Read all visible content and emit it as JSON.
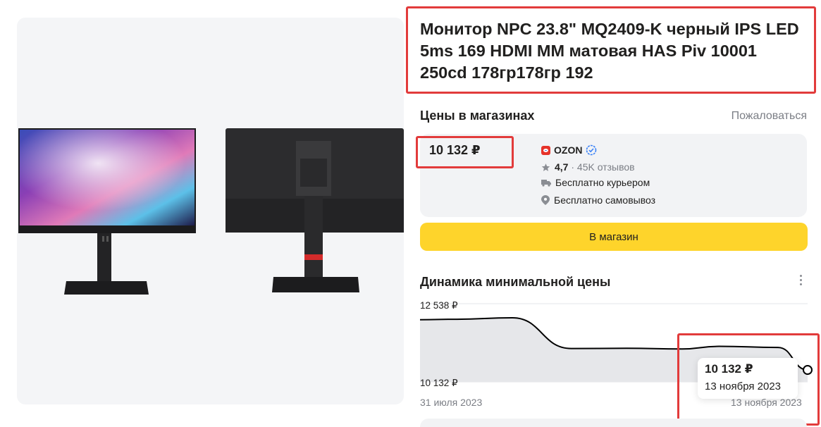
{
  "product": {
    "title": "Монитор NPC 23.8\" MQ2409-K черный IPS LED 5ms 169 HDMI MM матовая HAS Piv 10001 250cd 178гр178гр 192"
  },
  "prices_section": {
    "title": "Цены в магазинах",
    "complain_link": "Пожаловаться"
  },
  "offer": {
    "price": "10 132 ₽",
    "shop_name": "OZON",
    "shop_icon": "ozon-logo-icon",
    "verified_icon": "verified-badge-icon",
    "rating": "4,7",
    "reviews": "· 45K отзывов",
    "delivery": "Бесплатно курьером",
    "pickup": "Бесплатно самовывоз"
  },
  "buy_button": {
    "label": "В магазин"
  },
  "price_dynamics": {
    "title": "Динамика минимальной цены",
    "menu_icon": "more-vertical-icon",
    "tooltip": {
      "price": "10 132 ₽",
      "date": "13 ноября 2023"
    }
  },
  "chart_data": {
    "type": "line",
    "x": [
      "2023-07-31",
      "2023-08-10",
      "2023-08-25",
      "2023-09-10",
      "2023-09-25",
      "2023-10-10",
      "2023-10-20",
      "2023-11-05",
      "2023-11-13"
    ],
    "series": [
      {
        "values": [
          12450,
          12470,
          12538,
          11120,
          11130,
          11100,
          11220,
          11170,
          10132
        ]
      }
    ],
    "y_ticks": [
      "12 538 ₽",
      "10 132 ₽"
    ],
    "x_ticks": [
      "31 июля 2023",
      "13 ноября 2023"
    ],
    "ylim": [
      10132,
      12538
    ],
    "xlim": [
      "2023-07-31",
      "2023-11-13"
    ],
    "grid": true,
    "colors": {
      "line": "#000000",
      "area": "#e6e7ea"
    }
  },
  "colors": {
    "accent_button": "#fed42b",
    "highlight_box": "#e23b3b",
    "muted_text": "#7b7e85",
    "card_background": "#f2f3f5"
  }
}
